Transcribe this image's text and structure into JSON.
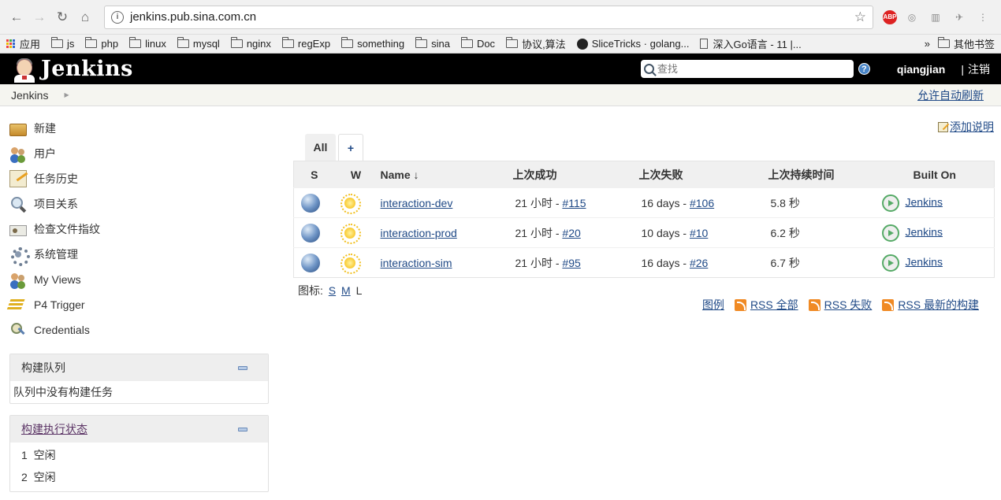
{
  "browser": {
    "url": "jenkins.pub.sina.com.cn",
    "bookmarks": [
      "应用",
      "js",
      "php",
      "linux",
      "mysql",
      "nginx",
      "regExp",
      "something",
      "sina",
      "Doc",
      "协议,算法",
      "SliceTricks · golang...",
      "深入Go语言 - 11 |..."
    ],
    "overflow": "»",
    "other_bookmarks": "其他书签",
    "abp_label": "ABP"
  },
  "header": {
    "logo_text": "Jenkins",
    "search_placeholder": "查找",
    "help": "?",
    "user": "qiangjian",
    "separator": "|",
    "logout": "注销"
  },
  "breadcrumb": {
    "root": "Jenkins",
    "auto_refresh": "允许自动刷新"
  },
  "sidebar": {
    "tasks": [
      {
        "label": "新建",
        "icon": "new-item-icon"
      },
      {
        "label": "用户",
        "icon": "people-icon"
      },
      {
        "label": "任务历史",
        "icon": "notepad-icon"
      },
      {
        "label": "项目关系",
        "icon": "search-icon"
      },
      {
        "label": "检查文件指纹",
        "icon": "fingerprint-icon"
      },
      {
        "label": "系统管理",
        "icon": "gear-icon"
      },
      {
        "label": "My Views",
        "icon": "people-icon"
      },
      {
        "label": "P4 Trigger",
        "icon": "p4-icon"
      },
      {
        "label": "Credentials",
        "icon": "credentials-icon"
      }
    ],
    "build_queue": {
      "title": "构建队列",
      "empty_text": "队列中没有构建任务"
    },
    "executors": {
      "title": "构建执行状态",
      "rows": [
        {
          "num": "1",
          "status": "空闲"
        },
        {
          "num": "2",
          "status": "空闲"
        }
      ]
    }
  },
  "main": {
    "add_description": "添加说明",
    "tabs": {
      "all": "All",
      "add": "+"
    },
    "columns": {
      "s": "S",
      "w": "W",
      "name": "Name ↓",
      "last_success": "上次成功",
      "last_failure": "上次失败",
      "last_duration": "上次持续时间",
      "built_on": "Built On"
    },
    "jobs": [
      {
        "name": "interaction-dev",
        "success_time": "21 小时 - ",
        "success_build": "#115",
        "failure_time": "16 days - ",
        "failure_build": "#106",
        "duration": "5.8 秒",
        "built_on": "Jenkins"
      },
      {
        "name": "interaction-prod",
        "success_time": "21 小时 - ",
        "success_build": "#20",
        "failure_time": "10 days - ",
        "failure_build": "#10",
        "duration": "6.2 秒",
        "built_on": "Jenkins"
      },
      {
        "name": "interaction-sim",
        "success_time": "21 小时 - ",
        "success_build": "#95",
        "failure_time": "16 days - ",
        "failure_build": "#26",
        "duration": "6.7 秒",
        "built_on": "Jenkins"
      }
    ],
    "icon_size": {
      "label": "图标:",
      "s": "S",
      "m": "M",
      "l": "L"
    },
    "legend": "图例",
    "rss_all": "RSS 全部",
    "rss_failed": "RSS 失败",
    "rss_latest": "RSS 最新的构建"
  }
}
